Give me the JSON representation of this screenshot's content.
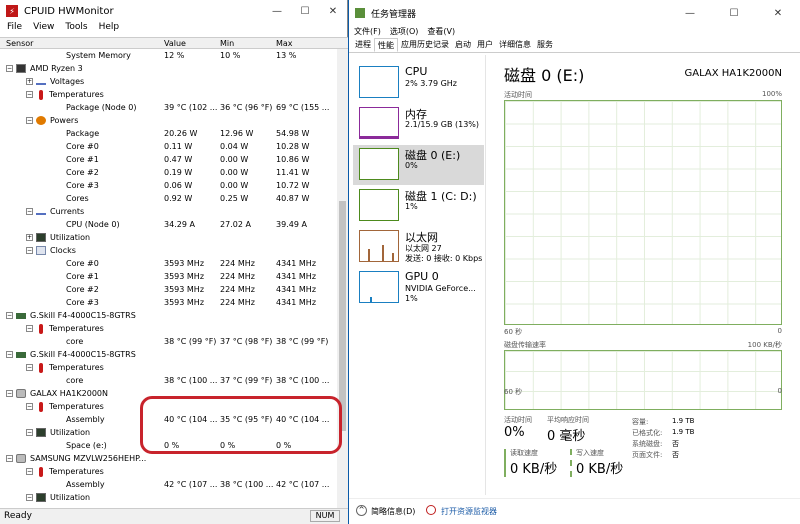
{
  "hwmonitor": {
    "title": "CPUID HWMonitor",
    "menu": [
      "File",
      "View",
      "Tools",
      "Help"
    ],
    "columns": {
      "sensor": "Sensor",
      "value": "Value",
      "min": "Min",
      "max": "Max"
    },
    "rows": [
      {
        "indent": 3,
        "icon": "",
        "name": "System Memory",
        "value": "12 %",
        "min": "10 %",
        "max": "13 %"
      },
      {
        "indent": 1,
        "icon": "cpu",
        "name": "AMD Ryzen 3",
        "toggle": "-"
      },
      {
        "indent": 2,
        "icon": "wave",
        "name": "Voltages",
        "toggle": "+"
      },
      {
        "indent": 2,
        "icon": "therm",
        "name": "Temperatures",
        "toggle": "-"
      },
      {
        "indent": 3,
        "icon": "",
        "name": "Package (Node 0)",
        "value": "39 °C (102 ...",
        "min": "36 °C (96 °F)",
        "max": "69 °C (155 ..."
      },
      {
        "indent": 2,
        "icon": "power",
        "name": "Powers",
        "toggle": "-"
      },
      {
        "indent": 3,
        "icon": "",
        "name": "Package",
        "value": "20.26 W",
        "min": "12.96 W",
        "max": "54.98 W"
      },
      {
        "indent": 3,
        "icon": "",
        "name": "Core #0",
        "value": "0.11 W",
        "min": "0.04 W",
        "max": "10.28 W"
      },
      {
        "indent": 3,
        "icon": "",
        "name": "Core #1",
        "value": "0.47 W",
        "min": "0.00 W",
        "max": "10.86 W"
      },
      {
        "indent": 3,
        "icon": "",
        "name": "Core #2",
        "value": "0.19 W",
        "min": "0.00 W",
        "max": "11.41 W"
      },
      {
        "indent": 3,
        "icon": "",
        "name": "Core #3",
        "value": "0.06 W",
        "min": "0.00 W",
        "max": "10.72 W"
      },
      {
        "indent": 3,
        "icon": "",
        "name": "Cores",
        "value": "0.92 W",
        "min": "0.25 W",
        "max": "40.87 W"
      },
      {
        "indent": 2,
        "icon": "wave",
        "name": "Currents",
        "toggle": "-"
      },
      {
        "indent": 3,
        "icon": "",
        "name": "CPU (Node 0)",
        "value": "34.29 A",
        "min": "27.02 A",
        "max": "39.49 A"
      },
      {
        "indent": 2,
        "icon": "util",
        "name": "Utilization",
        "toggle": "+"
      },
      {
        "indent": 2,
        "icon": "clock",
        "name": "Clocks",
        "toggle": "-"
      },
      {
        "indent": 3,
        "icon": "",
        "name": "Core #0",
        "value": "3593 MHz",
        "min": "224 MHz",
        "max": "4341 MHz"
      },
      {
        "indent": 3,
        "icon": "",
        "name": "Core #1",
        "value": "3593 MHz",
        "min": "224 MHz",
        "max": "4341 MHz"
      },
      {
        "indent": 3,
        "icon": "",
        "name": "Core #2",
        "value": "3593 MHz",
        "min": "224 MHz",
        "max": "4341 MHz"
      },
      {
        "indent": 3,
        "icon": "",
        "name": "Core #3",
        "value": "3593 MHz",
        "min": "224 MHz",
        "max": "4341 MHz"
      },
      {
        "indent": 1,
        "icon": "ram",
        "name": "G.Skill F4-4000C15-8GTRS",
        "toggle": "-"
      },
      {
        "indent": 2,
        "icon": "therm",
        "name": "Temperatures",
        "toggle": "-"
      },
      {
        "indent": 3,
        "icon": "",
        "name": "core",
        "value": "38 °C (99 °F)",
        "min": "37 °C (98 °F)",
        "max": "38 °C (99 °F)"
      },
      {
        "indent": 1,
        "icon": "ram",
        "name": "G.Skill F4-4000C15-8GTRS",
        "toggle": "-"
      },
      {
        "indent": 2,
        "icon": "therm",
        "name": "Temperatures",
        "toggle": "-"
      },
      {
        "indent": 3,
        "icon": "",
        "name": "core",
        "value": "38 °C (100 ...",
        "min": "37 °C (99 °F)",
        "max": "38 °C (100 ..."
      },
      {
        "indent": 1,
        "icon": "disk",
        "name": "GALAX HA1K2000N",
        "toggle": "-"
      },
      {
        "indent": 2,
        "icon": "therm",
        "name": "Temperatures",
        "toggle": "-"
      },
      {
        "indent": 3,
        "icon": "",
        "name": "Assembly",
        "value": "40 °C (104 ...",
        "min": "35 °C (95 °F)",
        "max": "40 °C (104 ..."
      },
      {
        "indent": 2,
        "icon": "util",
        "name": "Utilization",
        "toggle": "-"
      },
      {
        "indent": 3,
        "icon": "",
        "name": "Space (e:)",
        "value": "0 %",
        "min": "0 %",
        "max": "0 %"
      },
      {
        "indent": 1,
        "icon": "disk",
        "name": "SAMSUNG MZVLW256HEHP...",
        "toggle": "-"
      },
      {
        "indent": 2,
        "icon": "therm",
        "name": "Temperatures",
        "toggle": "-"
      },
      {
        "indent": 3,
        "icon": "",
        "name": "Assembly",
        "value": "42 °C (107 ...",
        "min": "38 °C (100 ...",
        "max": "42 °C (107 ..."
      },
      {
        "indent": 2,
        "icon": "util",
        "name": "Utilization",
        "toggle": "-"
      }
    ],
    "status": "Ready",
    "num": "NUM"
  },
  "taskmgr": {
    "title": "任务管理器",
    "menu": [
      "文件(F)",
      "选项(O)",
      "查看(V)"
    ],
    "tabs": [
      "进程",
      "性能",
      "应用历史记录",
      "启动",
      "用户",
      "详细信息",
      "服务"
    ],
    "active_tab": 1,
    "sidebar": [
      {
        "title": "CPU",
        "sub1": "2% 3.79 GHz",
        "sub2": "",
        "color": "#1a7fc1"
      },
      {
        "title": "内存",
        "sub1": "2.1/15.9 GB (13%)",
        "sub2": "",
        "color": "#8b2a9a"
      },
      {
        "title": "磁盘 0 (E:)",
        "sub1": "0%",
        "sub2": "",
        "color": "#4d8a1d",
        "selected": true
      },
      {
        "title": "磁盘 1 (C: D:)",
        "sub1": "1%",
        "sub2": "",
        "color": "#4d8a1d"
      },
      {
        "title": "以太网",
        "sub1": "以太网 27",
        "sub2": "发送: 0 接收: 0 Kbps",
        "color": "#a2663a"
      },
      {
        "title": "GPU 0",
        "sub1": "NVIDIA GeForce...",
        "sub2": "1%",
        "color": "#1a7fc1"
      }
    ],
    "main": {
      "title": "磁盘 0 (E:)",
      "model": "GALAX HA1K2000N",
      "graph1_label": "活动时间",
      "graph1_max": "100%",
      "graph1_time": "60 秒",
      "graph1_min": "0",
      "graph2_label": "磁盘传输速率",
      "graph2_max": "100 KB/秒",
      "graph2_time": "60 秒",
      "graph2_min": "0",
      "active_label": "活动时间",
      "active_value": "0%",
      "resp_label": "平均响应时间",
      "resp_value": "0 毫秒",
      "read_label": "读取速度",
      "read_value": "0 KB/秒",
      "write_label": "写入速度",
      "write_value": "0 KB/秒",
      "props": [
        {
          "k": "容量:",
          "v": "1.9 TB"
        },
        {
          "k": "已格式化:",
          "v": "1.9 TB"
        },
        {
          "k": "系统磁盘:",
          "v": "否"
        },
        {
          "k": "页面文件:",
          "v": "否"
        }
      ]
    },
    "footer": {
      "less": "简略信息(D)",
      "monitor": "打开资源监视器"
    }
  }
}
